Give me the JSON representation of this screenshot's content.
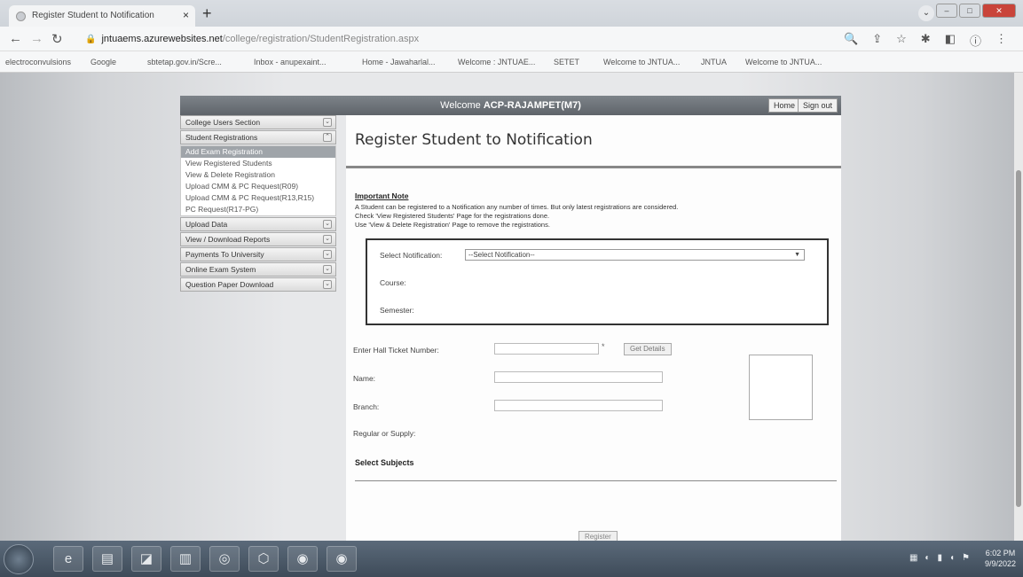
{
  "browser": {
    "tab_title": "Register Student to Notification",
    "tab_close": "×",
    "new_tab": "+",
    "url_host": "jntuaems.azurewebsites.net",
    "url_path": "/college/registration/StudentRegistration.aspx",
    "bookmarks": [
      "electroconvulsions",
      "Google",
      "sbtetap.gov.in/Scre...",
      "Inbox - anupexaint...",
      "Home - Jawaharlal...",
      "Welcome : JNTUAE...",
      "SETET",
      "Welcome to JNTUA...",
      "JNTUA",
      "Welcome to JNTUA..."
    ]
  },
  "header": {
    "welcome_prefix": "Welcome",
    "welcome_user": "ACP-RAJAMPET(M7)",
    "home_label": "Home",
    "signout_label": "Sign out"
  },
  "menu": {
    "sections": [
      {
        "label": "College Users Section",
        "chev": "⌄"
      },
      {
        "label": "Student Registrations",
        "chev": "⌃"
      }
    ],
    "subitems": [
      "Add Exam Registration",
      "View Registered Students",
      "View & Delete Registration",
      "Upload CMM & PC Request(R09)",
      "Upload CMM & PC Request(R13,R15)",
      "PC Request(R17-PG)"
    ],
    "sections_after": [
      {
        "label": "Upload Data",
        "chev": "⌄"
      },
      {
        "label": "View / Download Reports",
        "chev": "⌄"
      },
      {
        "label": "Payments To University",
        "chev": "⌄"
      },
      {
        "label": "Online Exam System",
        "chev": "⌄"
      },
      {
        "label": "Question Paper Download",
        "chev": "⌄"
      }
    ]
  },
  "main": {
    "title": "Register Student to Notification",
    "note_title": "Important Note",
    "note_lines": [
      "A Student can be registered to a Notification any number of times. But only latest registrations are considered.",
      "Check 'View Registered Students' Page for the registrations done.",
      "Use 'View & Delete Registration' Page to remove the registrations."
    ],
    "labels": {
      "notification": "Select Notification:",
      "course": "Course:",
      "semester": "Semester:",
      "hall_ticket": "Enter Hall Ticket Number:",
      "name": "Name:",
      "branch": "Branch:",
      "regular_supply": "Regular or Supply:"
    },
    "notification_select": "--Select Notification--",
    "required_mark": "*",
    "get_details_label": "Get Details",
    "select_subjects": "Select Subjects",
    "register_label": "Register"
  },
  "taskbar": {
    "time": "6:02 PM",
    "date": "9/9/2022"
  }
}
